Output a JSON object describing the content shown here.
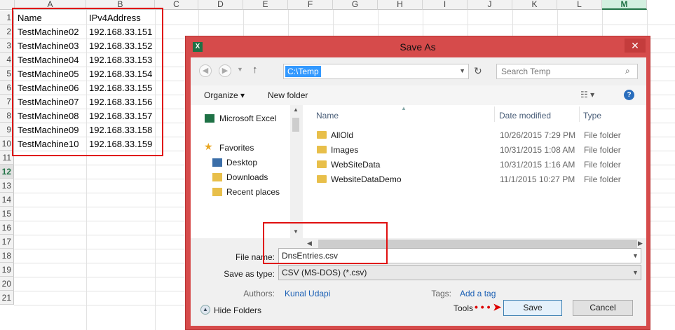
{
  "sheet": {
    "columns": [
      "A",
      "B",
      "C",
      "D",
      "E",
      "F",
      "G",
      "H",
      "I",
      "J",
      "K",
      "L",
      "M"
    ],
    "rows": [
      "1",
      "2",
      "3",
      "4",
      "5",
      "6",
      "7",
      "8",
      "9",
      "10",
      "11",
      "12",
      "13",
      "14",
      "15",
      "16",
      "17",
      "18",
      "19",
      "20",
      "21"
    ],
    "headers": [
      "Name",
      "IPv4Address"
    ],
    "data": [
      [
        "TestMachine02",
        "192.168.33.151"
      ],
      [
        "TestMachine03",
        "192.168.33.152"
      ],
      [
        "TestMachine04",
        "192.168.33.153"
      ],
      [
        "TestMachine05",
        "192.168.33.154"
      ],
      [
        "TestMachine06",
        "192.168.33.155"
      ],
      [
        "TestMachine07",
        "192.168.33.156"
      ],
      [
        "TestMachine08",
        "192.168.33.157"
      ],
      [
        "TestMachine09",
        "192.168.33.158"
      ],
      [
        "TestMachine10",
        "192.168.33.159"
      ]
    ]
  },
  "dialog": {
    "title": "Save As",
    "app_icon": "X",
    "close": "✕",
    "address": "C:\\Temp",
    "search_placeholder": "Search Temp",
    "organize": "Organize ▾",
    "new_folder": "New folder",
    "nav": {
      "excel": "Microsoft Excel",
      "favorites": "Favorites",
      "desktop": "Desktop",
      "downloads": "Downloads",
      "recent": "Recent places"
    },
    "file_headers": {
      "name": "Name",
      "date": "Date modified",
      "type": "Type"
    },
    "files": [
      {
        "name": "AllOld",
        "date": "10/26/2015 7:29 PM",
        "type": "File folder"
      },
      {
        "name": "Images",
        "date": "10/31/2015 1:08 AM",
        "type": "File folder"
      },
      {
        "name": "WebSiteData",
        "date": "10/31/2015 1:16 AM",
        "type": "File folder"
      },
      {
        "name": "WebsiteDataDemo",
        "date": "11/1/2015 10:27 PM",
        "type": "File folder"
      }
    ],
    "file_name_label": "File name:",
    "file_name": "DnsEntries.csv",
    "save_type_label": "Save as type:",
    "save_type": "CSV (MS-DOS) (*.csv)",
    "authors_label": "Authors:",
    "authors": "Kunal Udapi",
    "tags_label": "Tags:",
    "tags": "Add a tag",
    "hide_folders": "Hide Folders",
    "tools": "Tools",
    "save": "Save",
    "cancel": "Cancel"
  },
  "colors": {
    "excel_green": "#217346",
    "title_red": "#d64b4b",
    "highlight": "#e01010",
    "link": "#1a5fb4"
  }
}
